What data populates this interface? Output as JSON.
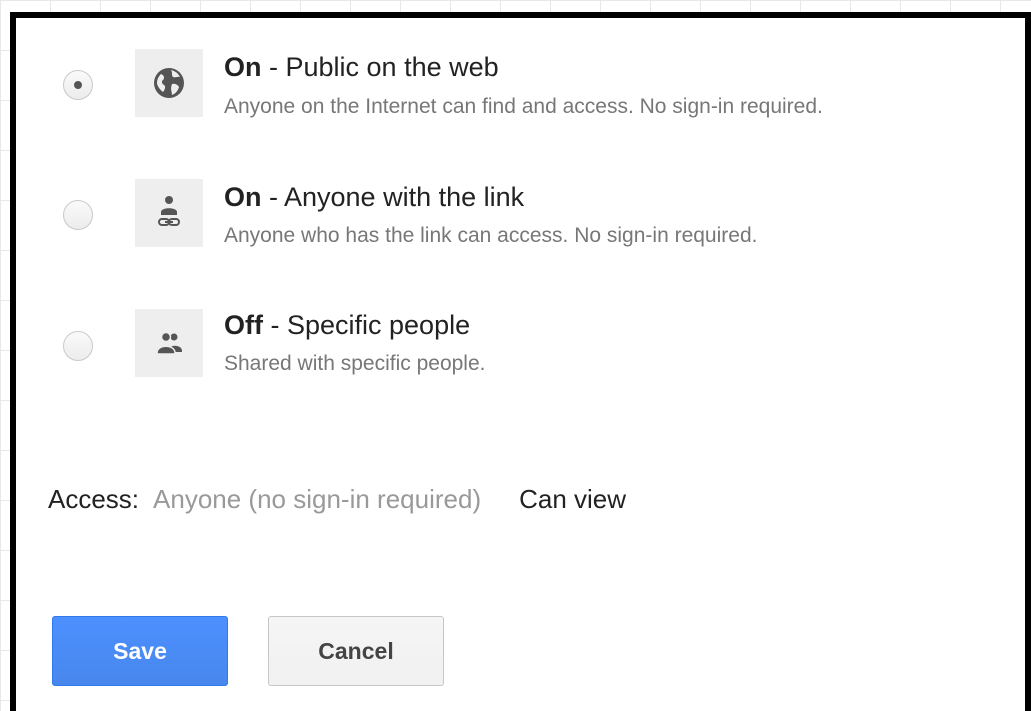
{
  "options": [
    {
      "title_bold": "On",
      "title_rest": " - Public on the web",
      "description": "Anyone on the Internet can find and access. No sign-in required.",
      "selected": true,
      "icon": "globe-icon"
    },
    {
      "title_bold": "On",
      "title_rest": " - Anyone with the link",
      "description": "Anyone who has the link can access. No sign-in required.",
      "selected": false,
      "icon": "person-link-icon"
    },
    {
      "title_bold": "Off",
      "title_rest": " - Specific people",
      "description": "Shared with specific people.",
      "selected": false,
      "icon": "people-icon"
    }
  ],
  "access": {
    "label": "Access:",
    "value": "Anyone (no sign-in required)",
    "permission": "Can view"
  },
  "buttons": {
    "save": "Save",
    "cancel": "Cancel"
  },
  "colors": {
    "primary": "#4d90fe",
    "icon": "#555555"
  }
}
